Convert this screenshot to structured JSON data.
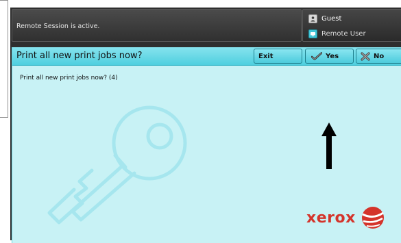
{
  "status": {
    "message": "Remote Session is active."
  },
  "user": {
    "primary": {
      "label": "Guest",
      "icon": "guest-user-icon"
    },
    "secondary": {
      "label": "Remote User",
      "icon": "remote-user-icon"
    }
  },
  "dialog": {
    "title": "Print all new print jobs now?",
    "message": "Print all new print jobs now? (4)",
    "buttons": {
      "exit": "Exit",
      "yes": {
        "label": "Yes",
        "icon": "checkmark-icon"
      },
      "no": {
        "label": "No",
        "icon": "x-icon"
      }
    }
  },
  "brand": {
    "name": "xerox",
    "color": "#d4342b"
  },
  "colors": {
    "dialog_background": "#c8f2f5",
    "title_bar": "#4fcfdf",
    "status_bar": "#3a3a3a"
  }
}
